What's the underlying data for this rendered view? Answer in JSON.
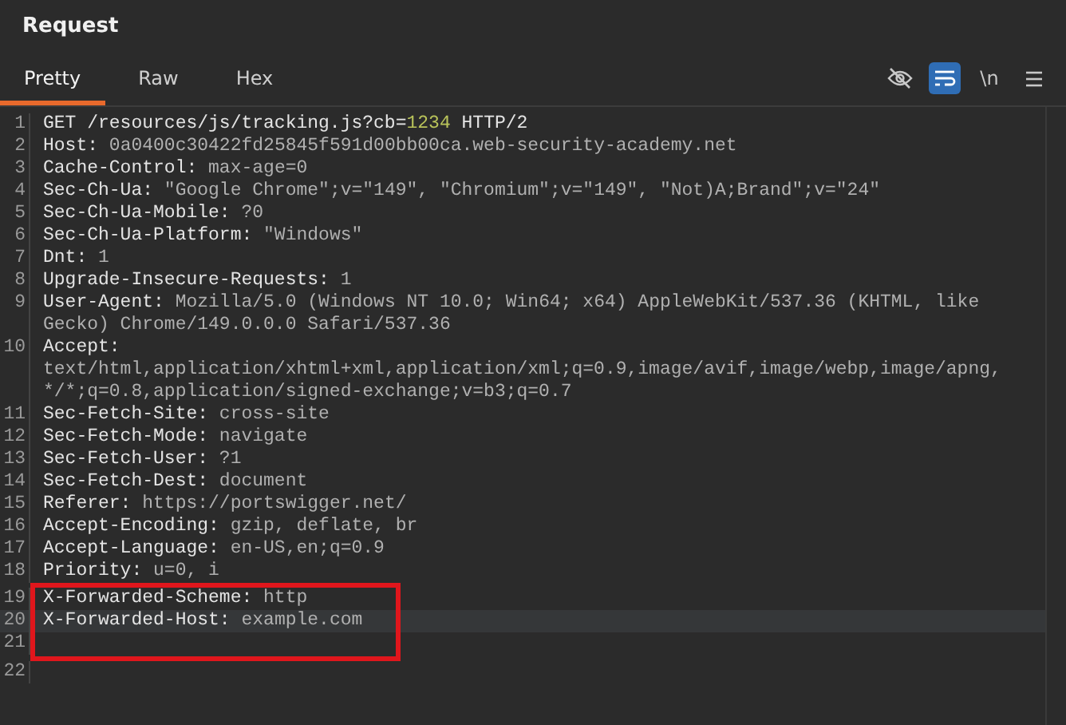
{
  "panel": {
    "title": "Request"
  },
  "tabs": [
    {
      "label": "Pretty",
      "selected": true
    },
    {
      "label": "Raw",
      "selected": false
    },
    {
      "label": "Hex",
      "selected": false
    }
  ],
  "toolbar": [
    {
      "kind": "hide",
      "on": false
    },
    {
      "kind": "wrap",
      "on": true
    },
    {
      "kind": "newline",
      "label": "\\n",
      "on": false
    },
    {
      "kind": "menu"
    }
  ],
  "lines": [
    {
      "number": "1",
      "selected": false,
      "boxed": false,
      "segments": [
        {
          "kind": "plain",
          "text": "GET /resources/js/tracking.js?cb="
        },
        {
          "kind": "param",
          "text": "1234"
        },
        {
          "kind": "plain",
          "text": " HTTP/2"
        }
      ]
    },
    {
      "number": "2",
      "selected": false,
      "boxed": false,
      "segments": [
        {
          "kind": "name",
          "text": "Host: "
        },
        {
          "kind": "value",
          "text": "0a0400c30422fd25845f591d00bb00ca.web-security-academy.net"
        }
      ]
    },
    {
      "number": "3",
      "selected": false,
      "boxed": false,
      "segments": [
        {
          "kind": "name",
          "text": "Cache-Control: "
        },
        {
          "kind": "value",
          "text": "max-age=0"
        }
      ]
    },
    {
      "number": "4",
      "selected": false,
      "boxed": false,
      "segments": [
        {
          "kind": "name",
          "text": "Sec-Ch-Ua: "
        },
        {
          "kind": "value",
          "text": "\"Google Chrome\";v=\"149\", \"Chromium\";v=\"149\", \"Not)A;Brand\";v=\"24\""
        }
      ]
    },
    {
      "number": "5",
      "selected": false,
      "boxed": false,
      "segments": [
        {
          "kind": "name",
          "text": "Sec-Ch-Ua-Mobile: "
        },
        {
          "kind": "value",
          "text": "?0"
        }
      ]
    },
    {
      "number": "6",
      "selected": false,
      "boxed": false,
      "segments": [
        {
          "kind": "name",
          "text": "Sec-Ch-Ua-Platform: "
        },
        {
          "kind": "value",
          "text": "\"Windows\""
        }
      ]
    },
    {
      "number": "7",
      "selected": false,
      "boxed": false,
      "segments": [
        {
          "kind": "name",
          "text": "Dnt: "
        },
        {
          "kind": "value",
          "text": "1"
        }
      ]
    },
    {
      "number": "8",
      "selected": false,
      "boxed": false,
      "segments": [
        {
          "kind": "name",
          "text": "Upgrade-Insecure-Requests: "
        },
        {
          "kind": "value",
          "text": "1"
        }
      ]
    },
    {
      "number": "9",
      "selected": false,
      "boxed": false,
      "segments": [
        {
          "kind": "name",
          "text": "User-Agent: "
        },
        {
          "kind": "value",
          "text": "Mozilla/5.0 (Windows NT 10.0; Win64; x64) AppleWebKit/537.36 (KHTML, like Gecko) Chrome/149.0.0.0 Safari/537.36"
        }
      ]
    },
    {
      "number": "10",
      "selected": false,
      "boxed": false,
      "segments": [
        {
          "kind": "name",
          "text": "Accept: "
        },
        {
          "kind": "value",
          "text": "text/html,application/xhtml+xml,application/xml;q=0.9,image/avif,image/webp,image/apng,*/*;q=0.8,application/signed-exchange;v=b3;q=0.7"
        }
      ]
    },
    {
      "number": "11",
      "selected": false,
      "boxed": false,
      "segments": [
        {
          "kind": "name",
          "text": "Sec-Fetch-Site: "
        },
        {
          "kind": "value",
          "text": "cross-site"
        }
      ]
    },
    {
      "number": "12",
      "selected": false,
      "boxed": false,
      "segments": [
        {
          "kind": "name",
          "text": "Sec-Fetch-Mode: "
        },
        {
          "kind": "value",
          "text": "navigate"
        }
      ]
    },
    {
      "number": "13",
      "selected": false,
      "boxed": false,
      "segments": [
        {
          "kind": "name",
          "text": "Sec-Fetch-User: "
        },
        {
          "kind": "value",
          "text": "?1"
        }
      ]
    },
    {
      "number": "14",
      "selected": false,
      "boxed": false,
      "segments": [
        {
          "kind": "name",
          "text": "Sec-Fetch-Dest: "
        },
        {
          "kind": "value",
          "text": "document"
        }
      ]
    },
    {
      "number": "15",
      "selected": false,
      "boxed": false,
      "segments": [
        {
          "kind": "name",
          "text": "Referer: "
        },
        {
          "kind": "value",
          "text": "https://portswigger.net/"
        }
      ]
    },
    {
      "number": "16",
      "selected": false,
      "boxed": false,
      "segments": [
        {
          "kind": "name",
          "text": "Accept-Encoding: "
        },
        {
          "kind": "value",
          "text": "gzip, deflate, br"
        }
      ]
    },
    {
      "number": "17",
      "selected": false,
      "boxed": false,
      "segments": [
        {
          "kind": "name",
          "text": "Accept-Language: "
        },
        {
          "kind": "value",
          "text": "en-US,en;q=0.9"
        }
      ]
    },
    {
      "number": "18",
      "selected": false,
      "boxed": false,
      "segments": [
        {
          "kind": "name",
          "text": "Priority: "
        },
        {
          "kind": "value",
          "text": "u=0, i"
        }
      ]
    },
    {
      "number": "19",
      "selected": false,
      "boxed": true,
      "segments": [
        {
          "kind": "name",
          "text": "X-Forwarded-Scheme: "
        },
        {
          "kind": "value",
          "text": "http"
        }
      ]
    },
    {
      "number": "20",
      "selected": true,
      "boxed": true,
      "segments": [
        {
          "kind": "name",
          "text": "X-Forwarded-Host: "
        },
        {
          "kind": "value",
          "text": "example.com"
        }
      ]
    },
    {
      "number": "21",
      "selected": false,
      "boxed": true
    },
    {
      "number": "22",
      "selected": false,
      "boxed": false
    }
  ]
}
